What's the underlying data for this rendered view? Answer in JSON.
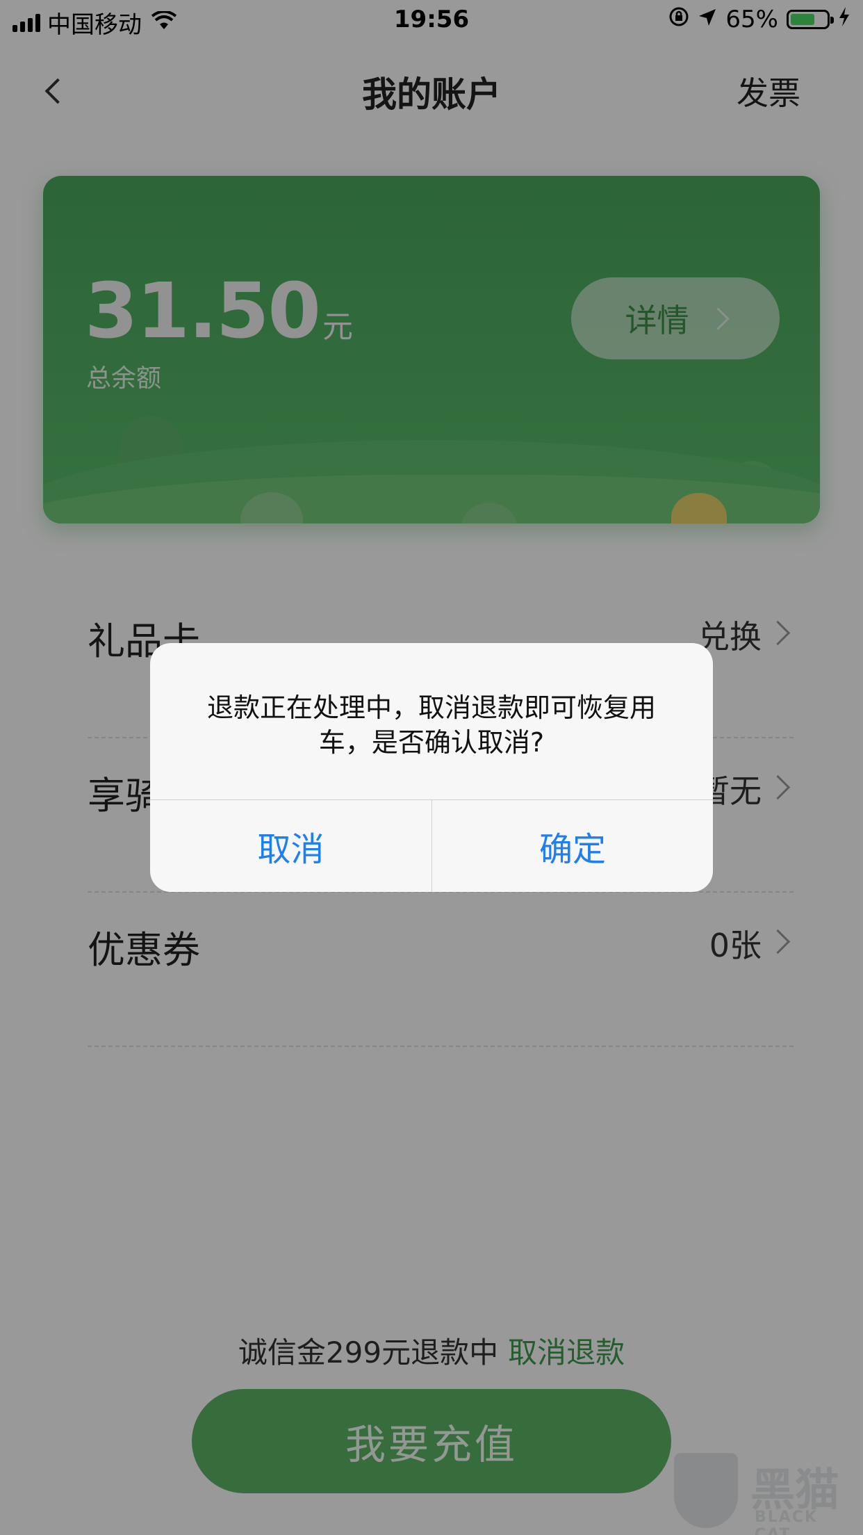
{
  "status_bar": {
    "carrier": "中国移动",
    "time": "19:56",
    "battery_percent": "65%",
    "battery_level": 0.65,
    "icons": [
      "signal-icon",
      "wifi-icon",
      "rotation-lock-icon",
      "location-icon",
      "battery-icon",
      "charging-icon"
    ]
  },
  "nav": {
    "title": "我的账户",
    "right_action": "发票",
    "back_icon": "chevron-left-icon"
  },
  "account_card": {
    "amount": "31.50",
    "unit": "元",
    "label": "总余额",
    "detail_button": "详情"
  },
  "list": [
    {
      "label": "礼品卡",
      "value": "兑换"
    },
    {
      "label": "享骑",
      "value": "暂无"
    },
    {
      "label": "优惠券",
      "value": "0张"
    }
  ],
  "deposit": {
    "text": "诚信金299元退款中",
    "action": "取消退款"
  },
  "recharge_button": "我要充值",
  "watermark": {
    "title": "黑猫",
    "subtitle": "BLACK CAT"
  },
  "alert": {
    "message": "退款正在处理中，取消退款即可恢复用车，是否确认取消?",
    "cancel": "取消",
    "confirm": "确定"
  },
  "colors": {
    "brand_green": "#4aa85a",
    "link_blue": "#1f7ef0",
    "overlay": "rgba(0,0,0,0.40)"
  }
}
